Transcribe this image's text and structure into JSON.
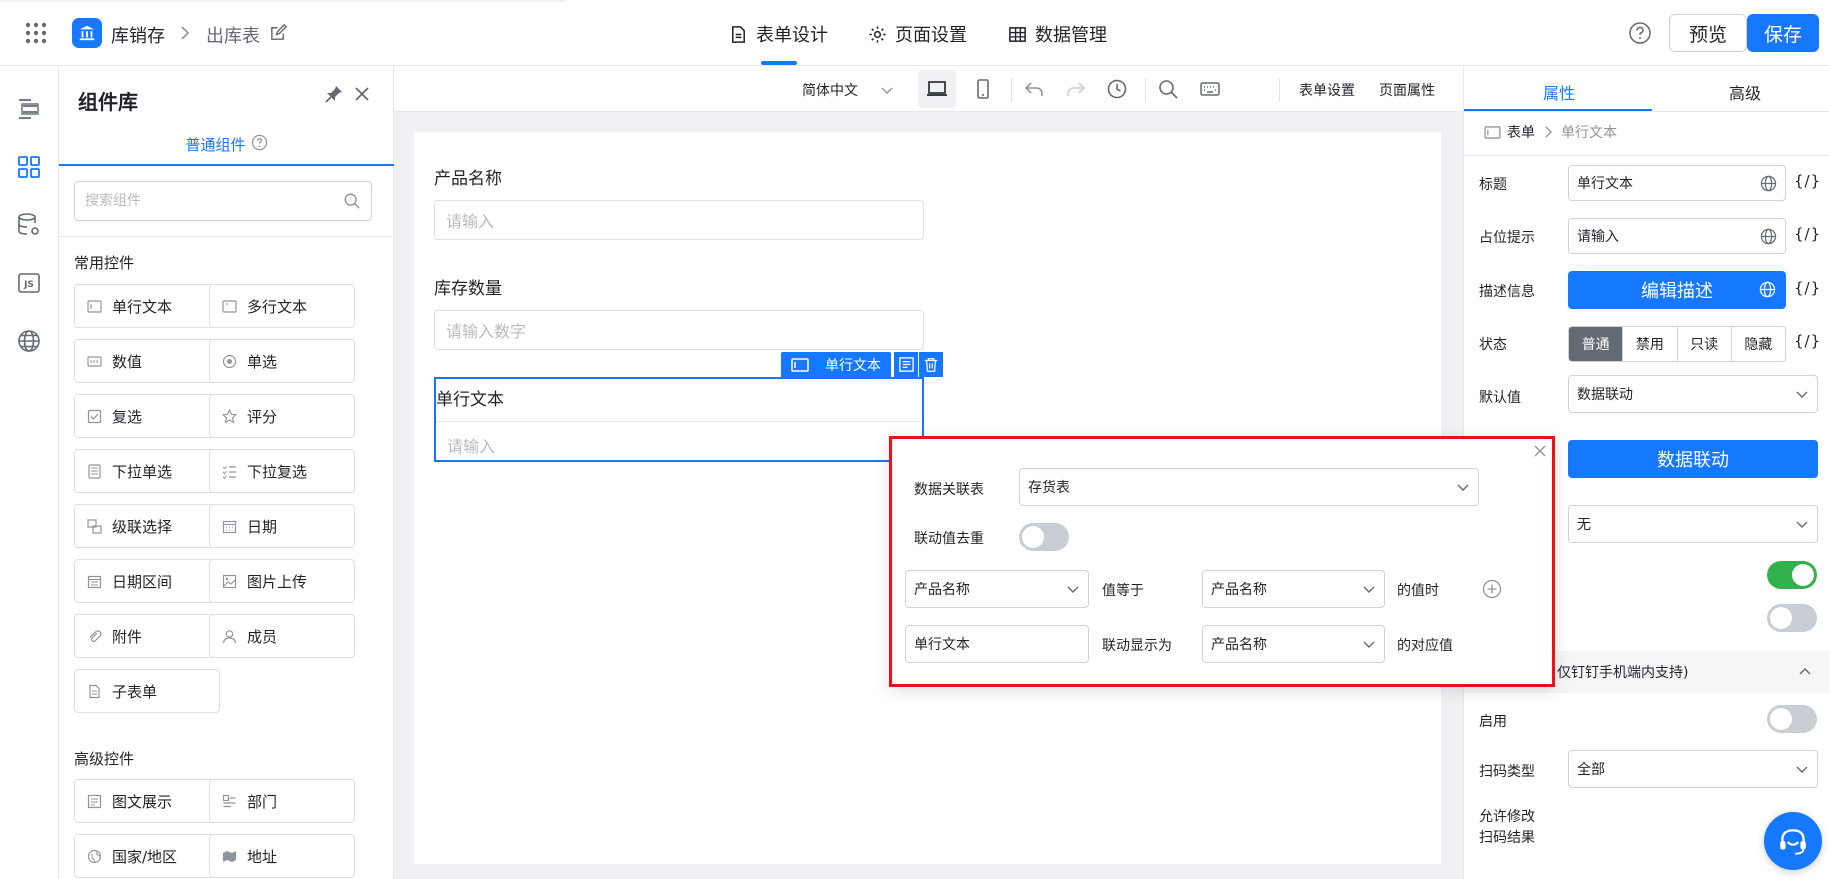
{
  "topbar": {
    "app_name": "库销存",
    "page_name": "出库表",
    "tabs": [
      {
        "label": "表单设计",
        "icon": "document-icon",
        "active": true
      },
      {
        "label": "页面设置",
        "icon": "gear-icon",
        "active": false
      },
      {
        "label": "数据管理",
        "icon": "grid-icon",
        "active": false
      }
    ],
    "preview_label": "预览",
    "save_label": "保存",
    "accent": "#1677ff"
  },
  "library": {
    "title": "组件库",
    "tab_label": "普通组件",
    "search_placeholder": "搜索组件",
    "common_title": "常用控件",
    "common": [
      {
        "label": "单行文本",
        "icon": "single-line-text-icon"
      },
      {
        "label": "多行文本",
        "icon": "multi-line-text-icon"
      },
      {
        "label": "数值",
        "icon": "number-icon"
      },
      {
        "label": "单选",
        "icon": "radio-icon"
      },
      {
        "label": "复选",
        "icon": "checkbox-icon"
      },
      {
        "label": "评分",
        "icon": "star-icon"
      },
      {
        "label": "下拉单选",
        "icon": "dropdown-icon"
      },
      {
        "label": "下拉复选",
        "icon": "dropdown-multi-icon"
      },
      {
        "label": "级联选择",
        "icon": "cascade-icon"
      },
      {
        "label": "日期",
        "icon": "calendar-icon"
      },
      {
        "label": "日期区间",
        "icon": "date-range-icon"
      },
      {
        "label": "图片上传",
        "icon": "image-icon"
      },
      {
        "label": "附件",
        "icon": "paperclip-icon"
      },
      {
        "label": "成员",
        "icon": "user-icon"
      },
      {
        "label": "子表单",
        "icon": "subform-icon"
      }
    ],
    "advanced_title": "高级控件",
    "advanced": [
      {
        "label": "图文展示",
        "icon": "rich-text-icon"
      },
      {
        "label": "部门",
        "icon": "department-icon"
      },
      {
        "label": "国家/地区",
        "icon": "globe-icon"
      },
      {
        "label": "地址",
        "icon": "map-icon"
      }
    ]
  },
  "toolbar": {
    "language": "简体中文",
    "form_settings": "表单设置",
    "page_props": "页面属性"
  },
  "form": {
    "fields": [
      {
        "label": "产品名称",
        "placeholder": "请输入"
      },
      {
        "label": "库存数量",
        "placeholder": "请输入数字"
      },
      {
        "label": "单行文本",
        "placeholder": "请输入"
      }
    ],
    "selected_tag": "单行文本"
  },
  "props": {
    "tabs": [
      "属性",
      "高级"
    ],
    "breadcrumb_root": "表单",
    "breadcrumb_current": "单行文本",
    "title_label": "标题",
    "title_value": "单行文本",
    "placeholder_label": "占位提示",
    "placeholder_value": "请输入",
    "desc_label": "描述信息",
    "desc_button": "编辑描述",
    "state_label": "状态",
    "states": [
      "普通",
      "禁用",
      "只读",
      "隐藏"
    ],
    "default_label": "默认值",
    "default_value": "数据联动",
    "linkage_button": "数据联动",
    "none_value": "无",
    "section_title": "仅钉钉手机端内支持)",
    "enable_label": "启用",
    "scan_type_label": "扫码类型",
    "scan_type_value": "全部",
    "allow_modify_label_1": "允许修改",
    "allow_modify_label_2": "扫码结果",
    "var_token": "{/}"
  },
  "popup": {
    "table_label": "数据关联表",
    "table_value": "存货表",
    "dedupe_label": "联动值去重",
    "cond_field": "产品名称",
    "equals_label": "值等于",
    "cond_target": "产品名称",
    "when_label": "的值时",
    "display_field": "单行文本",
    "display_label": "联动显示为",
    "display_target": "产品名称",
    "value_label": "的对应值"
  }
}
